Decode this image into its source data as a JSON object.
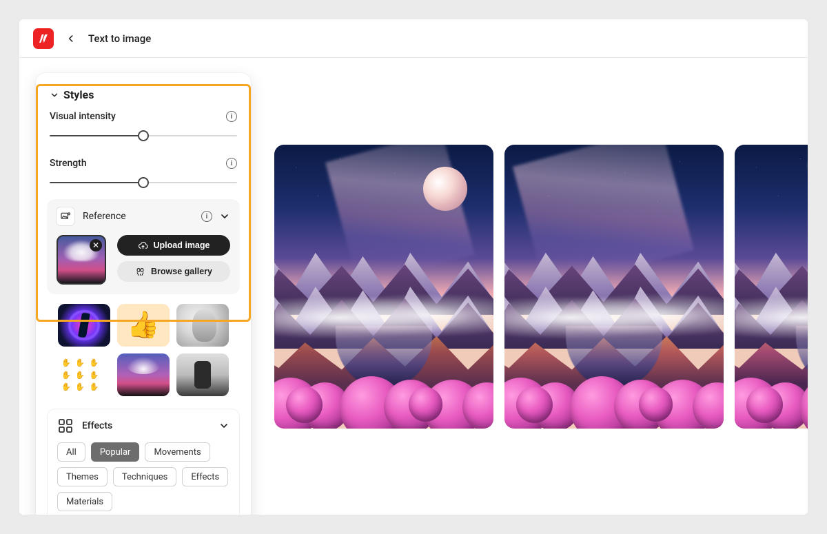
{
  "topbar": {
    "title": "Text to image"
  },
  "styles": {
    "header": "Styles",
    "visual_intensity": {
      "label": "Visual intensity",
      "value_pct": 50
    },
    "strength": {
      "label": "Strength",
      "value_pct": 50
    }
  },
  "reference": {
    "label": "Reference",
    "upload_label": "Upload image",
    "browse_label": "Browse gallery"
  },
  "style_tiles": [
    {
      "name": "neon-ring"
    },
    {
      "name": "3d-thumbs-up"
    },
    {
      "name": "marble-bust"
    },
    {
      "name": "hand-pattern"
    },
    {
      "name": "pink-clouds"
    },
    {
      "name": "portrait-dark"
    }
  ],
  "effects": {
    "label": "Effects",
    "chips": [
      "All",
      "Popular",
      "Movements",
      "Themes",
      "Techniques",
      "Effects",
      "Materials"
    ],
    "active_chip": "Popular"
  }
}
